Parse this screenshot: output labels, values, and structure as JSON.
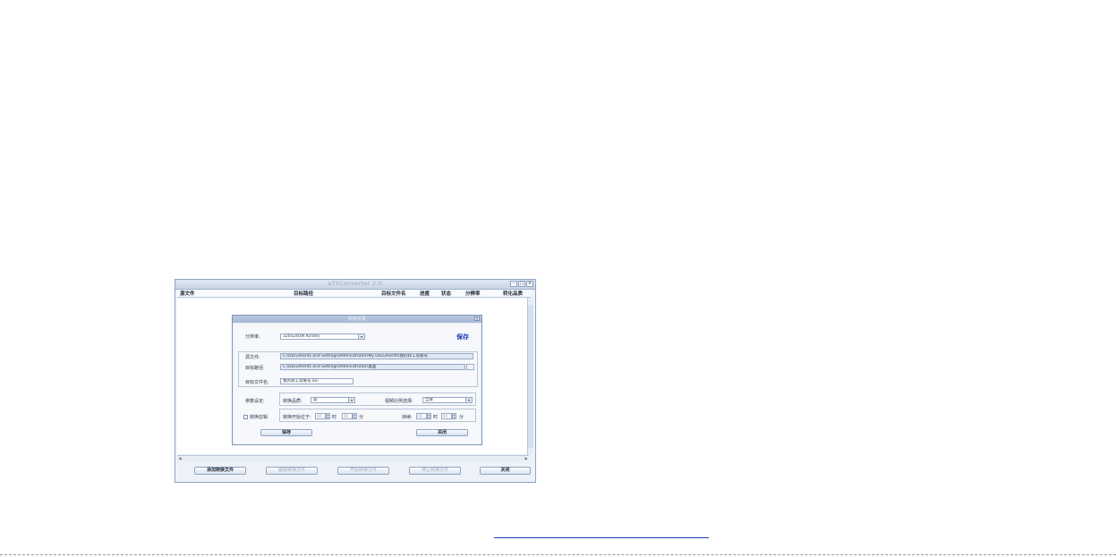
{
  "window": {
    "title": "eTSConverter 2.0",
    "controls": {
      "minimize": "-",
      "maximize": "□",
      "close": "×"
    }
  },
  "table": {
    "headers": [
      "源文件",
      "目标路径",
      "目标文件名",
      "进度",
      "状态",
      "分辨率",
      "转化品质"
    ]
  },
  "dialog": {
    "title": "转换设置",
    "close": "×",
    "resolution_label": "分辨率:",
    "resolution_value": "320x240(K Kindle)",
    "apply_link": "保存",
    "source_label": "源文件:",
    "source_value": "C:\\Documents and Settings\\Administrator\\My Documents\\我的转工资账号",
    "target_path_label": "目标路径:",
    "target_path_value": "C:\\Documents and Settings\\Administrator\\桌面",
    "browse_label": "...",
    "target_name_label": "目标文件名:",
    "target_name_value": "我的转工资账号.avi",
    "params_label": "参数设定:",
    "quality_label": "转换品质:",
    "quality_value": "高",
    "subtitle_label": "视频比例选择:",
    "subtitle_value": "全屏",
    "trim_label": "转换剪辑",
    "start_label": "转换开始位于:",
    "hour_label": "时",
    "minute_label": "分",
    "length_label": "持续:",
    "spin_value": "00",
    "save_button": "保存",
    "close_button": "关闭"
  },
  "bottom": {
    "add_button": "添加转换文件",
    "delete_button": "删除转换文件",
    "start_button": "开始转换文件",
    "stop_button": "停止转换文件",
    "close_button": "关闭"
  },
  "colors": {
    "window_border": "#8ea4c4",
    "dialog_title": "#a6b8d4",
    "link": "#1c3bb5"
  }
}
